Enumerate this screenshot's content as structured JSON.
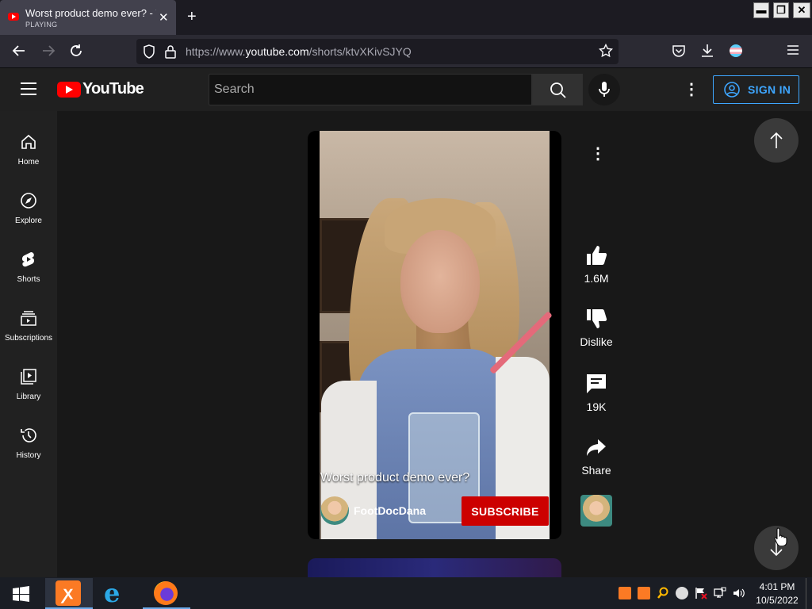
{
  "browser": {
    "tab_title": "Worst product demo ever? - YouTube",
    "tab_status": "PLAYING",
    "url_prefix": "https://www.",
    "url_domain": "youtube.com",
    "url_path": "/shorts/ktvXKivSJYQ"
  },
  "youtube": {
    "logo_text": "YouTube",
    "search_placeholder": "Search",
    "sign_in": "SIGN IN",
    "brand_color": "#ff0000"
  },
  "sidebar": {
    "items": [
      {
        "label": "Home",
        "icon": "home-icon"
      },
      {
        "label": "Explore",
        "icon": "compass-icon"
      },
      {
        "label": "Shorts",
        "icon": "shorts-icon"
      },
      {
        "label": "Subscriptions",
        "icon": "subscriptions-icon"
      },
      {
        "label": "Library",
        "icon": "library-icon"
      },
      {
        "label": "History",
        "icon": "history-icon"
      }
    ]
  },
  "video": {
    "caption": "Worst product demo ever?",
    "channel": "FootDocDana",
    "subscribe": "SUBSCRIBE"
  },
  "actions": {
    "likes": "1.6M",
    "dislike": "Dislike",
    "comments": "19K",
    "share": "Share"
  },
  "taskbar": {
    "time": "4:01 PM",
    "date": "10/5/2022"
  }
}
